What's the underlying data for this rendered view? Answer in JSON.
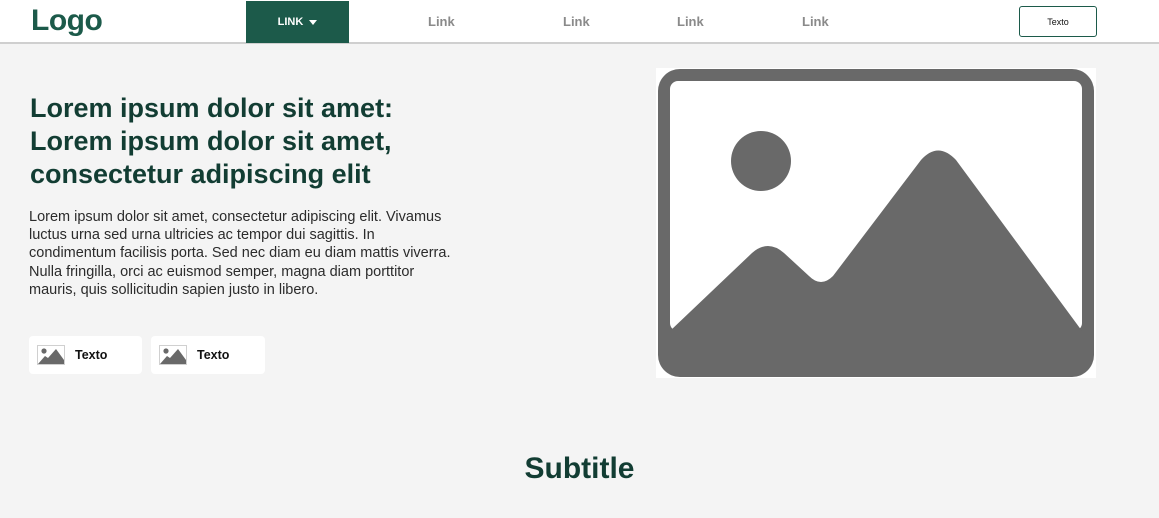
{
  "navbar": {
    "logo": "Logo",
    "active_link": "LINK",
    "links": [
      "Link",
      "Link",
      "Link",
      "Link"
    ],
    "button_label": "Texto"
  },
  "hero": {
    "title_lines": [
      "Lorem ipsum dolor sit amet:",
      "Lorem ipsum dolor sit amet,",
      "consectetur adipiscing elit"
    ],
    "body": "Lorem ipsum dolor sit amet, consectetur adipiscing elit. Vivamus luctus urna sed urna ultricies ac tempor dui sagittis. In condimentum facilisis porta. Sed nec diam eu diam mattis viverra. Nulla fringilla, orci ac euismod semper, magna diam porttitor mauris, quis sollicitudin sapien justo in libero.",
    "buttons": [
      {
        "label": "Texto",
        "icon": "image-icon"
      },
      {
        "label": "Texto",
        "icon": "image-icon"
      }
    ],
    "image_icon": "image-placeholder-icon"
  },
  "section": {
    "subtitle": "Subtitle"
  },
  "colors": {
    "brand": "#1c5a4a",
    "heading": "#123d33",
    "background": "#f4f4f4",
    "placeholder": "#696969"
  }
}
